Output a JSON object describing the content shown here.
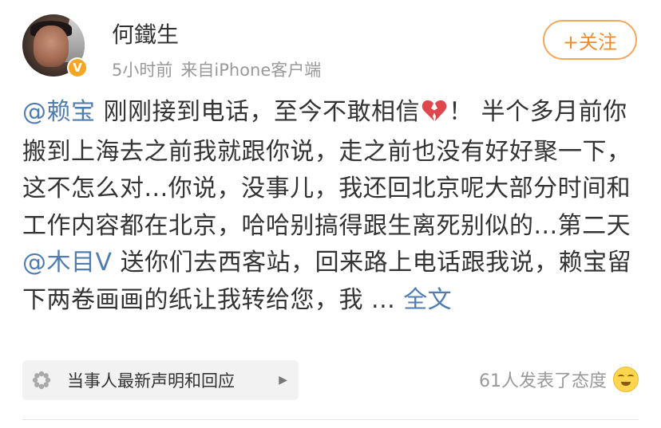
{
  "user": {
    "name": "何鐵生",
    "time": "5小时前",
    "source": "来自iPhone客户端",
    "verified_badge": "V"
  },
  "follow_button": {
    "label": "+关注"
  },
  "post": {
    "mention1": "@赖宝",
    "text1": " 刚刚接到电话，至今不敢相信",
    "text2": "！ 半个多月前你搬到上海去之前我就跟你说，走之前也没有好好聚一下，这不怎么对...你说，没事儿，我还回北京呢大部分时间和工作内容都在北京，哈哈别搞得跟生离死别似的...第二天 ",
    "mention2": "@木目V",
    "text3": " 送你们去西客站，回来路上电话跟我说，赖宝留下两卷画画的纸让我转给您，我 ... ",
    "more_link": "全文"
  },
  "topic": {
    "label": "当事人最新声明和回应",
    "arrow": "▶"
  },
  "reactions": {
    "text": "61人发表了态度"
  },
  "colors": {
    "link": "#507daf",
    "follow": "#f28b2c",
    "badge": "#f6a623"
  },
  "icons": [
    "verified-icon",
    "broken-heart-icon",
    "topic-flower-icon",
    "chevron-right-icon",
    "crying-face-emoji"
  ]
}
